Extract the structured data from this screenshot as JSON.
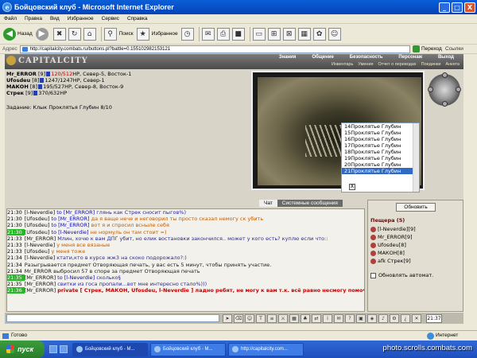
{
  "window": {
    "title": "Бойцовский клуб - Microsoft Internet Explorer",
    "min": "_",
    "max": "□",
    "close": "X"
  },
  "menu": [
    "Файл",
    "Правка",
    "Вид",
    "Избранное",
    "Сервис",
    "Справка"
  ],
  "toolbar": {
    "back": "Назад",
    "search": "Поиск",
    "favorites": "Избранное"
  },
  "address": {
    "label": "Адрес",
    "value": "http://capitalcity.combats.ru/buttons.pl?battle=0.155102982153121",
    "go": "Переход",
    "links": "Ссылки"
  },
  "game": {
    "logo": "CAPITALCITY",
    "nav": [
      "Знания",
      "Общение",
      "Безопасность",
      "Персонаж",
      "Выход"
    ],
    "subnav": [
      "Инвентарь",
      "Умения",
      "Отчет о переводах",
      "Поединки",
      "Анкета"
    ],
    "players": [
      {
        "name": "Mr_ERROR",
        "level": "[9]",
        "hp": "120/512",
        "suffix": "HP, Север-5, Восток-1"
      },
      {
        "name": "Ufosdeu",
        "level": "[8]",
        "hp": "1247/1247",
        "suffix": "HP, Север-1"
      },
      {
        "name": "МАКОН",
        "level": "[8]",
        "hp": "195/527",
        "suffix": "HP, Север-8, Восток-9"
      },
      {
        "name": "Стрек",
        "level": "[9]",
        "hp": "370/632",
        "suffix": "HP"
      }
    ],
    "task": "Задание: Клык Проклятья Глубин 8/10",
    "dropdown": [
      "14Проклятье Глубин",
      "15Проклятье Глубин",
      "16Проклятье Глубин",
      "17Проклятье Глубин",
      "18Проклятье Глубин",
      "19Проклятье Глубин",
      "20Проклятье Глубин",
      "21Проклятье Глубин"
    ],
    "dropdown_selected": 7,
    "dropdown_close": "X",
    "tabs": {
      "chat": "Чат",
      "system": "Системные сообщения"
    },
    "chat": [
      {
        "time": "21:30",
        "nick": "[l-Neverdie]",
        "to": " to [Mr_ERROR] ",
        "msg": "глянь как Стрек сносит пыгов%)",
        "style": "blue",
        "hl": false
      },
      {
        "time": "21:30",
        "nick": "[Ufosdeu]",
        "to": " to [Mr_ERROR] ",
        "msg": "да я ваще нече и неговорил ты просто сказал немогу ск убить",
        "style": "",
        "hl": false
      },
      {
        "time": "21:30",
        "nick": "[Ufosdeu]",
        "to": " to [Mr_ERROR] ",
        "msg": "вот я и спросил всныле себя",
        "style": "",
        "hl": false
      },
      {
        "time": "21:30",
        "nick": "[Ufosdeu]",
        "to": " to [l-Neverdie] ",
        "msg": "не нормуль он там стоит =)",
        "style": "",
        "hl": true
      },
      {
        "time": "21:33",
        "nick": "[Mr_ERROR]",
        "to": " ",
        "msg": "Млин, хочю к вам ДПГ убит, но елик востановки закончился.. может у кого есть? куплю если что::",
        "style": "blue",
        "hl": false
      },
      {
        "time": "21:33",
        "nick": "[l-Neverdie]",
        "to": " ",
        "msg": "у меня все вязаные",
        "style": "",
        "hl": false
      },
      {
        "time": "21:33",
        "nick": "[Ufosdeu]",
        "to": " ",
        "msg": "у меня тоже",
        "style": "",
        "hl": false
      },
      {
        "time": "21:34",
        "nick": "[l-Neverdie]",
        "to": " ",
        "msg": "ктати,кто в курсе жж3 на скоко подорожало?:)",
        "style": "blue",
        "hl": false
      },
      {
        "time": "21:34",
        "nick": "",
        "to": "",
        "msg": "Разыгрывается предмет Отворяющая печать, у вас есть 5 минут, чтобы принять участие.",
        "style": "dark",
        "hl": false
      },
      {
        "time": "21:34",
        "nick": "Mr_ERROR",
        "to": " ",
        "msg": "выбросил 57 в споре за предмет Отворяющая печать",
        "style": "dark",
        "hl": false
      },
      {
        "time": "21:35",
        "nick": "[Mr_ERROR]",
        "to": " to [l-Neverdie] ",
        "msg": "сколько§",
        "style": "blue",
        "hl": true
      },
      {
        "time": "21:35",
        "nick": "[Mr_ERROR]",
        "to": " ",
        "msg": "свитки из госа пропали...вот мне интересно стало%)))",
        "style": "blue",
        "hl": false
      },
      {
        "time": "21:36",
        "nick": "[Mr_ERROR]",
        "to": " ",
        "msg": "private [ Стрек, МАКОН, Ufosdeu, l-Neverdie ] ладно ребят, не могу к вам т.к. всё равно несмогу помоч, восстановки нету, удачи и спс за поход",
        "style": "red",
        "hl": true
      }
    ],
    "refresh": "Обновить",
    "location_title": "Пещера (5)",
    "location_users": [
      "[l-Neverdie][9]",
      "Mr_ERROR[9]",
      "Ufosdeu[8]",
      "МАКОН[8]",
      "afk Стрек[9]"
    ],
    "auto_refresh": "Обновлять автомат.",
    "clock": "21:37"
  },
  "status": {
    "done": "Готово",
    "zone": "Интернет"
  },
  "taskbar": {
    "start": "пуск",
    "items": [
      "Бойцовский клуб - M...",
      "Бойцовский клуб - M...",
      "http://capitalcity.com..."
    ]
  },
  "watermark": "photo.scrolls.combats.com"
}
